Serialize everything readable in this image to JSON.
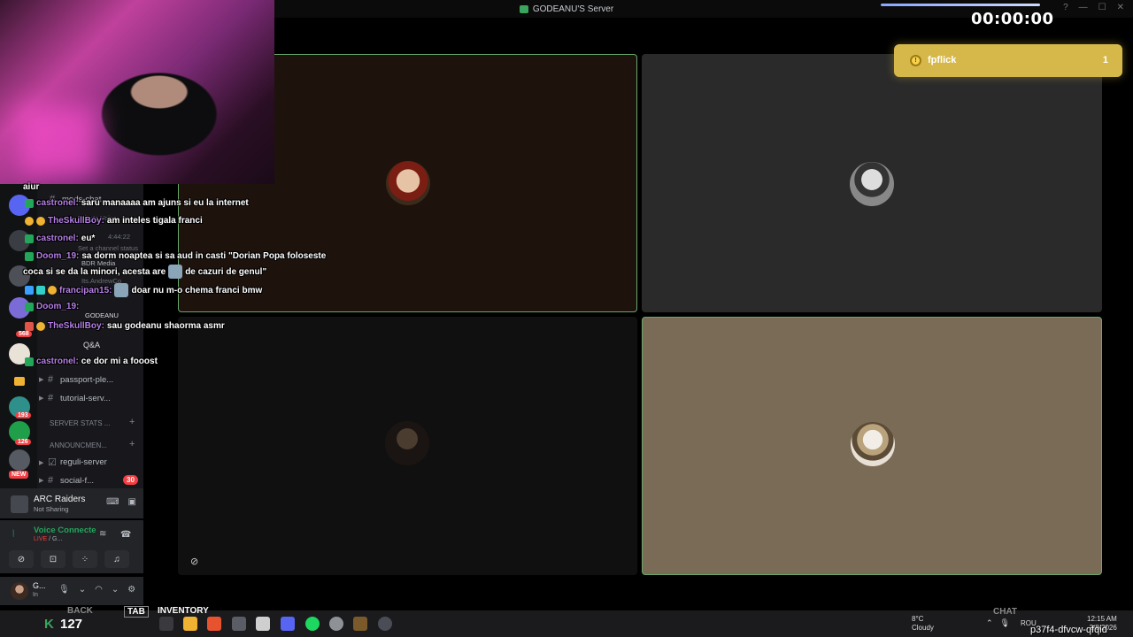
{
  "window": {
    "server_title": "GODEANU'S Server",
    "controls": [
      "?",
      "—",
      "☐",
      "✕"
    ]
  },
  "timer": "00:00:00",
  "notification": {
    "name": "fpflick",
    "count": "1",
    "accent": "#d6b84a"
  },
  "channels": {
    "mods_chat": "mods-chat",
    "private_voice": "Private Voice",
    "set_status": "Set a channel status",
    "time": "4:44:22",
    "members": [
      "BDR Media",
      "Its.AndrewCo",
      "GODEANU"
    ],
    "passport": "passport-ple...",
    "tutorial": "tutorial-serv...",
    "server_stats": "SERVER STATS ...",
    "announcements": "ANNOUNCMEN...",
    "reguli": "reguli-server",
    "social": "social-f...",
    "social_unread": "30",
    "qa": "Q&A"
  },
  "guild_badges": [
    "193",
    "126",
    "568"
  ],
  "new_badge": "NEW",
  "activity": {
    "name": "ARC Raiders",
    "sub": "Not Sharing"
  },
  "voice": {
    "title": "Voice Connecte",
    "live": "LIVE",
    "sub": "/ G..."
  },
  "user": {
    "name": "G...",
    "status": "In"
  },
  "chat": [
    {
      "user": "castronel:",
      "text": "saru manaaaa am ajuns si eu la internet",
      "color": "#b57ee6"
    },
    {
      "user": "TheSkullBoy:",
      "text": "am inteles tigala franci",
      "color": "#b57ee6"
    },
    {
      "user": "castronel:",
      "text": "eu*",
      "color": "#b57ee6"
    },
    {
      "user": "Doom_19:",
      "text": "sa dorm noaptea si sa aud in casti \"Dorian Popa foloseste",
      "color": "#b57ee6"
    },
    {
      "user": "",
      "text": "coca si se da la minori, acesta are",
      "color": "#ffffff"
    },
    {
      "user": "",
      "text": "de cazuri de genul\"",
      "color": "#ffffff"
    },
    {
      "user": "francipan15:",
      "text": "doar nu m-o chema franci bmw",
      "color": "#b57ee6"
    },
    {
      "user": "Doom_19:",
      "text": "",
      "color": "#b57ee6"
    },
    {
      "user": "TheSkullBoy:",
      "text": "sau godeanu shaorma asmr",
      "color": "#b57ee6"
    },
    {
      "user": "castronel:",
      "text": "ce dor mi a fooost",
      "color": "#b57ee6"
    },
    {
      "user": "",
      "text": "aiur",
      "color": "#ffffff"
    }
  ],
  "game_hud": {
    "k": "K",
    "num": "127",
    "back": "BACK",
    "tab": "TAB",
    "inventory": "INVENTORY",
    "chat": "CHAT"
  },
  "taskbar": {
    "weather_temp": "8°C",
    "weather_desc": "Cloudy",
    "lang": "ROU",
    "time": "12:15 AM",
    "date": "2/8/2026",
    "watermark": "p37f4-dfvcw-qfqid"
  }
}
